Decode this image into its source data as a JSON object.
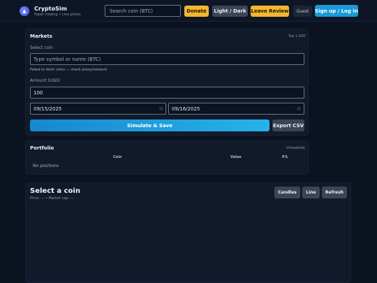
{
  "header": {
    "logo_glyph": "▲",
    "brand_name": "CryptoSim",
    "brand_tagline": "Paper trading • Live prices",
    "search_placeholder": "Search coin (BTC)",
    "donate_label": "Donate",
    "theme_label": "Light / Dark",
    "review_label": "Leave Review",
    "guest_label": "Guest",
    "signup_label": "Sign up / Log in"
  },
  "markets": {
    "title": "Markets",
    "meta": "Top 1,000",
    "select_label": "Select coin",
    "coin_placeholder": "Type symbol or name (BTC)",
    "error_text": "Failed to fetch coins — check proxy/network",
    "amount_label": "Amount (USD)",
    "amount_value": "100",
    "start_date": "09/15/2025",
    "end_date": "09/16/2025",
    "date_icon": "calendar-icon",
    "simulate_label": "Simulate & Save",
    "export_label": "Export CSV"
  },
  "portfolio": {
    "title": "Portfolio",
    "meta": "Unrealized",
    "columns": [
      "Coin",
      "Value",
      "P/L"
    ],
    "empty_text": "No positions"
  },
  "chart": {
    "title": "Select a coin",
    "subtitle": "Price: — • Market cap: —",
    "candles_label": "Candles",
    "line_label": "Line",
    "refresh_label": "Refresh"
  },
  "colors": {
    "background": "#0b1220",
    "accent": "#1a9ad6",
    "highlight": "#f2b632"
  }
}
